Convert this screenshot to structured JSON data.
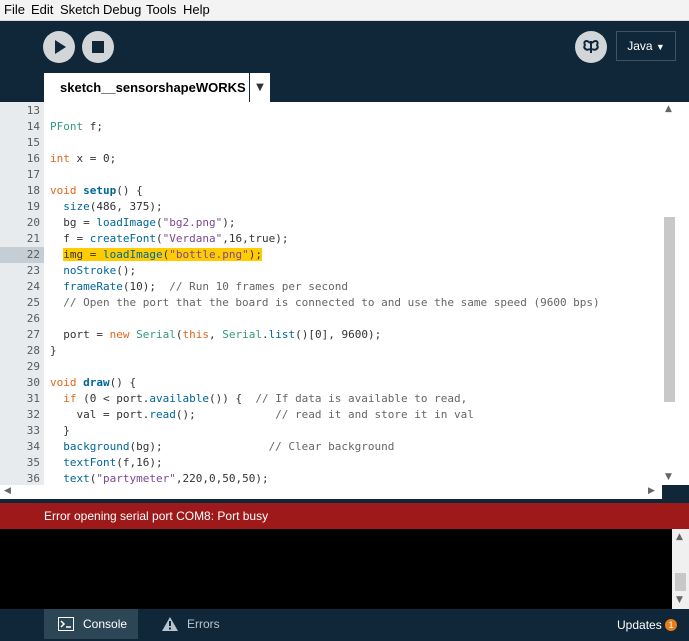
{
  "menu": [
    "File",
    "Edit",
    "Sketch",
    "Debug",
    "Tools",
    "Help"
  ],
  "toolbar": {
    "mode": "Java",
    "mode_arrow": "▼"
  },
  "tab": {
    "name": "sketch__sensorshapeWORKS",
    "menu_arrow": "▼"
  },
  "editor": {
    "highlighted_line": 22,
    "lines": [
      {
        "n": "13",
        "t": ""
      },
      {
        "n": "14",
        "t": "PFont f;"
      },
      {
        "n": "15",
        "t": ""
      },
      {
        "n": "16",
        "t": "int x = 0;"
      },
      {
        "n": "17",
        "t": ""
      },
      {
        "n": "18",
        "t": "void setup() {"
      },
      {
        "n": "19",
        "t": "  size(486, 375);"
      },
      {
        "n": "20",
        "t": "  bg = loadImage(\"bg2.png\");"
      },
      {
        "n": "21",
        "t": "  f = createFont(\"Verdana\",16,true);"
      },
      {
        "n": "22",
        "t": "  img = loadImage(\"bottle.png\");"
      },
      {
        "n": "23",
        "t": "  noStroke();"
      },
      {
        "n": "24",
        "t": "  frameRate(10);  // Run 10 frames per second"
      },
      {
        "n": "25",
        "t": "  // Open the port that the board is connected to and use the same speed (9600 bps)"
      },
      {
        "n": "26",
        "t": ""
      },
      {
        "n": "27",
        "t": "  port = new Serial(this, Serial.list()[0], 9600);"
      },
      {
        "n": "28",
        "t": "}"
      },
      {
        "n": "29",
        "t": ""
      },
      {
        "n": "30",
        "t": "void draw() {"
      },
      {
        "n": "31",
        "t": "  if (0 < port.available()) {  // If data is available to read,"
      },
      {
        "n": "32",
        "t": "    val = port.read();            // read it and store it in val"
      },
      {
        "n": "33",
        "t": "  }"
      },
      {
        "n": "34",
        "t": "  background(bg);                // Clear background"
      },
      {
        "n": "35",
        "t": "  textFont(f,16);"
      },
      {
        "n": "36",
        "t": "  text(\"partymeter\",220,0,50,50);"
      }
    ]
  },
  "status": {
    "message": "Error opening serial port COM8: Port busy"
  },
  "bottom": {
    "console_label": "Console",
    "errors_label": "Errors",
    "updates_label": "Updates",
    "updates_count": "1"
  },
  "colors": {
    "bg": "#0f2738",
    "error": "#9e1a1a",
    "highlight": "#ffcc00",
    "keyword": "#e2661a",
    "function": "#006699",
    "string": "#7d4793",
    "comment": "#666666",
    "badge": "#e97e19"
  },
  "icons": {
    "run": "play-icon",
    "stop": "stop-icon",
    "debug": "butterfly-icon",
    "console": "console-icon",
    "errors": "warning-icon"
  }
}
